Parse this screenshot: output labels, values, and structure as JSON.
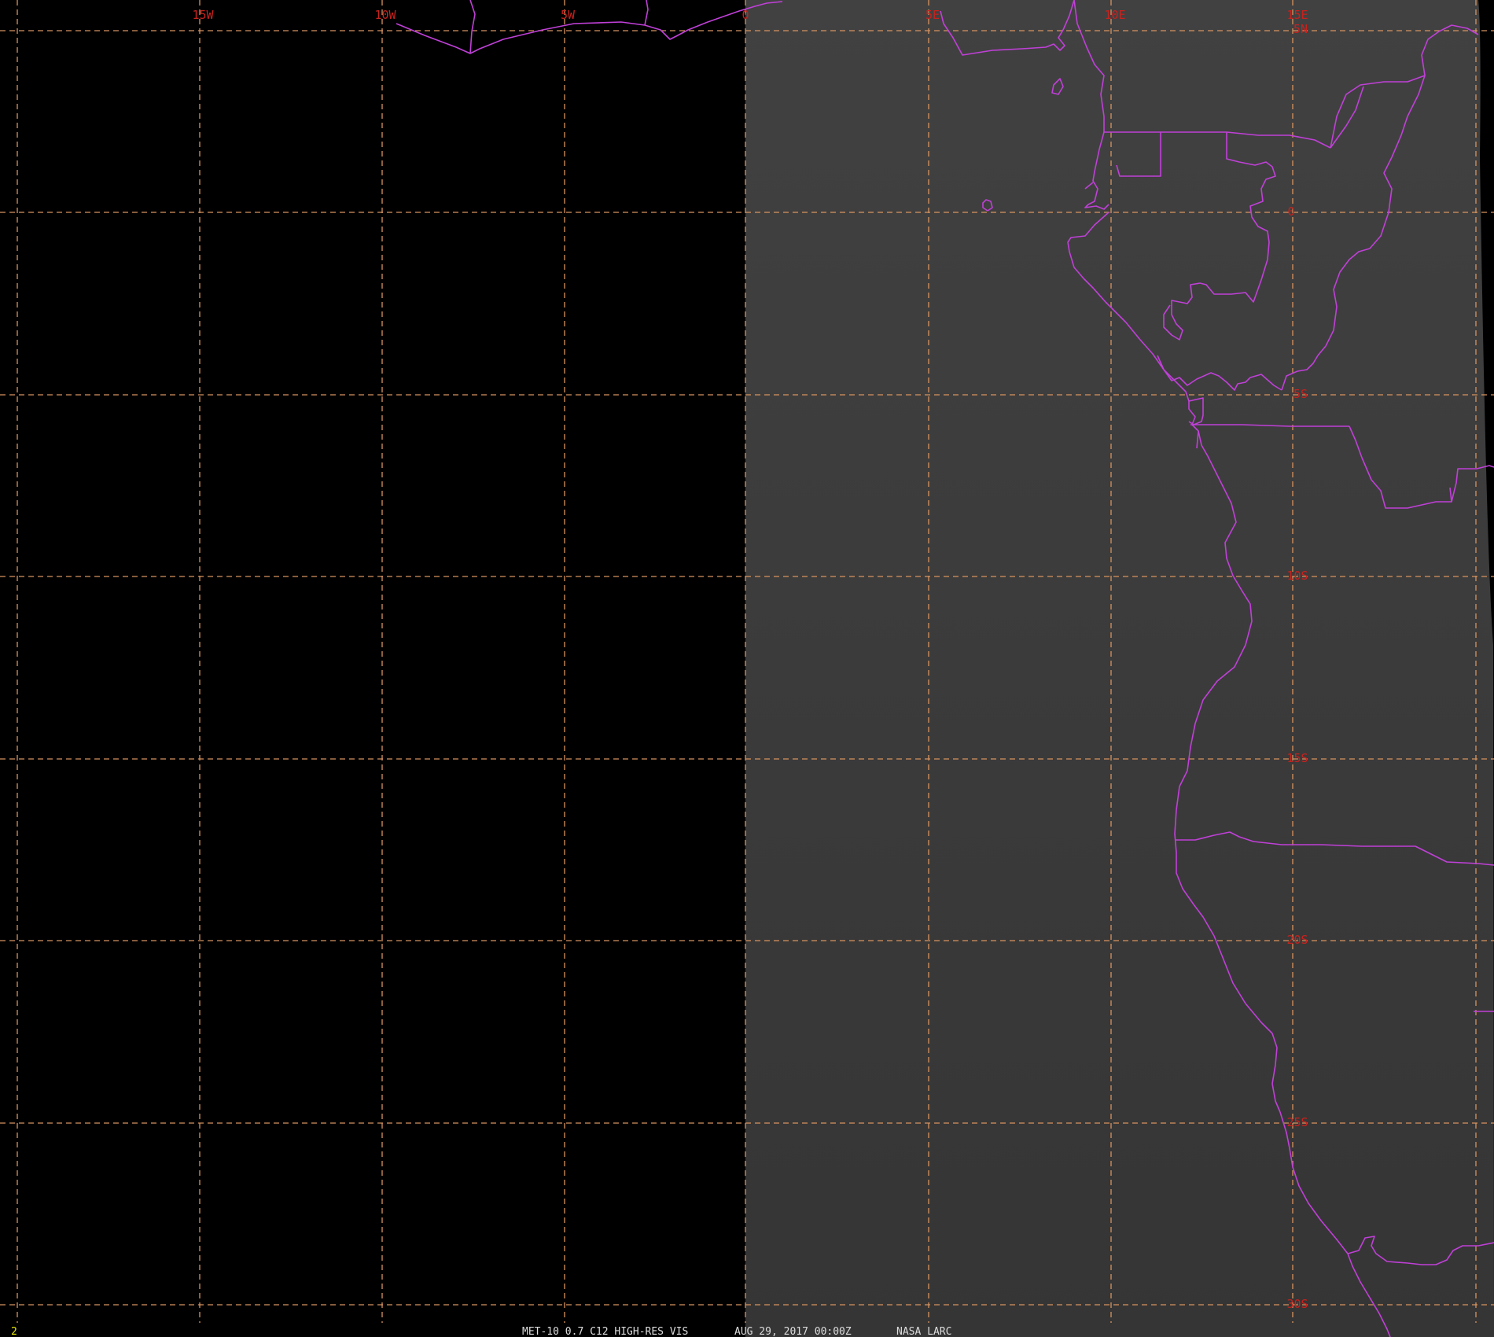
{
  "image": {
    "satellite_product": "MET-10 0.7 C12 HIGH-RES VIS",
    "datetime": "AUG 29, 2017 00:00Z",
    "source": "NASA LARC",
    "frame_number": "2"
  },
  "colors": {
    "background": "#000000",
    "satellite_panel": "#3a3a3a",
    "grid": "#d7935f",
    "coastlines": "#c040d8",
    "grid_labels": "#c8221e",
    "footer_text": "#dddddd",
    "frame_number": "#e8e800"
  },
  "grid": {
    "longitude_labels": [
      "15W",
      "10W",
      "5W",
      "0",
      "5E",
      "10E",
      "15E"
    ],
    "latitude_labels": [
      "5N",
      "0",
      "5S",
      "10S",
      "15S",
      "20S",
      "25S",
      "30S"
    ]
  }
}
